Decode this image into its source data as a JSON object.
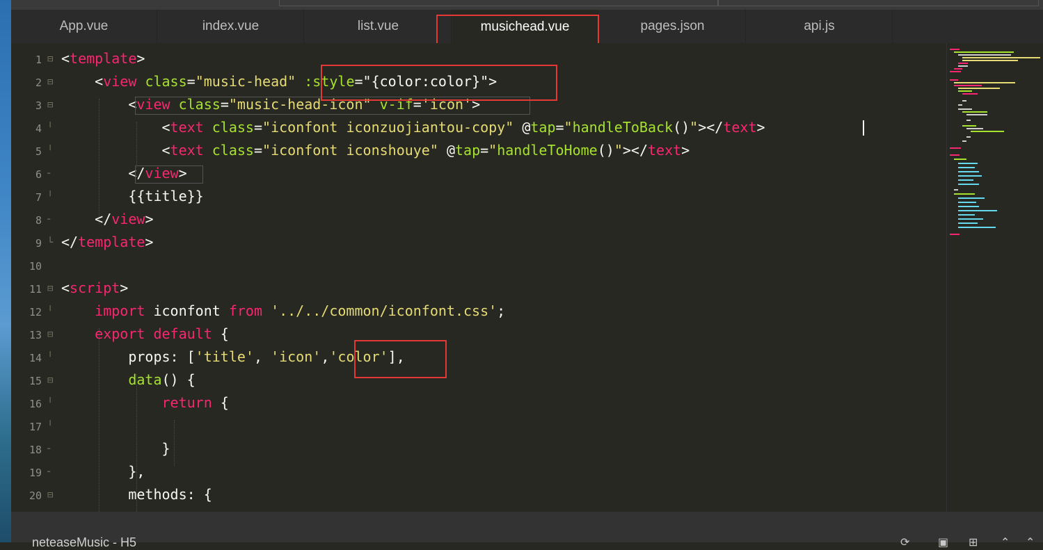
{
  "tabs": [
    {
      "label": "App.vue"
    },
    {
      "label": "index.vue"
    },
    {
      "label": "list.vue"
    },
    {
      "label": "musichead.vue"
    },
    {
      "label": "pages.json"
    },
    {
      "label": "api.js"
    }
  ],
  "active_tab": "musichead.vue",
  "line_numbers": [
    "1",
    "2",
    "3",
    "4",
    "5",
    "6",
    "7",
    "8",
    "9",
    "10",
    "11",
    "12",
    "13",
    "14",
    "15",
    "16",
    "17",
    "18",
    "19",
    "20"
  ],
  "code": {
    "l1": {
      "lt": "<",
      "tag": "template",
      "gt": ">"
    },
    "l2": {
      "lt": "<",
      "tag": "view",
      "attr": "class",
      "eq": "=",
      "val": "\"music-head\"",
      "style_attr": ":style",
      "eq2": "=",
      "style_val": "\"{color:color}\"",
      "gt": ">"
    },
    "l3": {
      "lt": "<",
      "tag": "view",
      "attr": "class",
      "eq": "=",
      "val": "\"music-head-icon\"",
      "attr2": "v-if",
      "eq2": "=",
      "val2": "'icon'",
      "gt": ">"
    },
    "l4": {
      "lt": "<",
      "tag": "text",
      "attr": "class",
      "eq": "=",
      "val": "\"iconfont iconzuojiantou-copy\"",
      "at": "@",
      "attr2": "tap",
      "eq2": "=",
      "q1": "\"",
      "fn": "handleToBack",
      "call": "()",
      "q2": "\"",
      "close": "></",
      "tag2": "text",
      "gt": ">"
    },
    "l5": {
      "lt": "<",
      "tag": "text",
      "attr": "class",
      "eq": "=",
      "val": "\"iconfont iconshouye\"",
      "at": "@",
      "attr2": "tap",
      "eq2": "=",
      "q1": "\"",
      "fn": "handleToHome",
      "call": "()",
      "q2": "\"",
      "close": "></",
      "tag2": "text",
      "gt": ">"
    },
    "l6": {
      "lt": "</",
      "tag": "view",
      "gt": ">"
    },
    "l7": {
      "text": "{{title}}"
    },
    "l8": {
      "lt": "</",
      "tag": "view",
      "gt": ">"
    },
    "l9": {
      "lt": "</",
      "tag": "template",
      "gt": ">"
    },
    "l11": {
      "lt": "<",
      "tag": "script",
      "gt": ">"
    },
    "l12": {
      "kw": "import",
      "name": " iconfont ",
      "kw2": "from",
      "sp": " ",
      "str": "'../../common/iconfont.css'",
      "end": ";"
    },
    "l13": {
      "kw": "export",
      "sp": " ",
      "kw2": "default",
      "rest": " {"
    },
    "l14": {
      "key": "props",
      "punct": ": [",
      "s1": "'title'",
      "c1": ", ",
      "s2": "'icon'",
      "c2": ",",
      "s3": "'color'",
      "end": "],"
    },
    "l15": {
      "fn": "data",
      "rest": "() {"
    },
    "l16": {
      "kw": "return",
      "rest": " {"
    },
    "l18": {
      "text": "}"
    },
    "l19": {
      "text": "},"
    },
    "l20": {
      "key": "methods",
      "rest": ": {"
    }
  },
  "status": {
    "text": "neteaseMusic - H5"
  },
  "colors": {
    "background": "#272822",
    "tag": "#f92672",
    "attribute": "#a6e22e",
    "string": "#e6db74",
    "highlight_box": "#e53935"
  },
  "icons": [
    "collapse-icon",
    "fold-marker-icon",
    "sync-icon",
    "window-icon",
    "new-terminal-icon",
    "chevron-up-icon"
  ]
}
